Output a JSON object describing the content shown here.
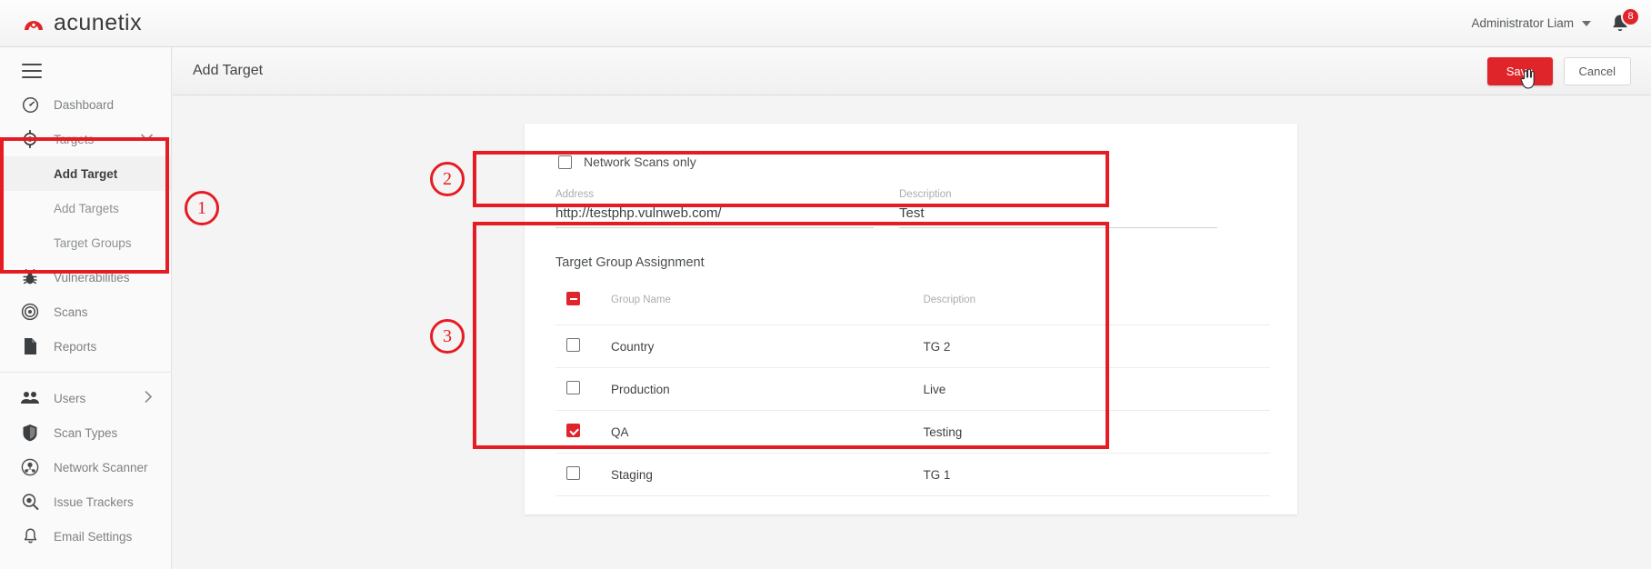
{
  "app": {
    "brand": "acunetix",
    "brand_icon": "acunetix-logo-icon"
  },
  "topbar": {
    "user_name": "Administrator Liam",
    "user_caret_icon": "chevron-down-icon",
    "bell_icon": "bell-icon",
    "notification_count": "8"
  },
  "sidebar": {
    "menu_icon": "hamburger-icon",
    "items": [
      {
        "label": "Dashboard",
        "icon": "gauge-icon",
        "type": "item"
      },
      {
        "label": "Targets",
        "icon": "crosshair-icon",
        "type": "item",
        "chevron": "chevron-down-icon",
        "expanded": true
      },
      {
        "label": "Add Target",
        "type": "sub",
        "active": true
      },
      {
        "label": "Add Targets",
        "type": "sub",
        "active": false
      },
      {
        "label": "Target Groups",
        "type": "sub",
        "active": false
      },
      {
        "label": "Vulnerabilities",
        "icon": "bug-icon",
        "type": "item"
      },
      {
        "label": "Scans",
        "icon": "radar-icon",
        "type": "item"
      },
      {
        "label": "Reports",
        "icon": "document-icon",
        "type": "item"
      },
      {
        "label": "Users",
        "icon": "users-icon",
        "type": "item",
        "chevron": "chevron-right-icon"
      },
      {
        "label": "Scan Types",
        "icon": "shield-icon",
        "type": "item"
      },
      {
        "label": "Network Scanner",
        "icon": "network-scanner-icon",
        "type": "item"
      },
      {
        "label": "Issue Trackers",
        "icon": "issue-tracker-icon",
        "type": "item"
      },
      {
        "label": "Email Settings",
        "icon": "bell-outline-icon",
        "type": "item"
      }
    ]
  },
  "page": {
    "title": "Add Target",
    "save_label": "Save",
    "cancel_label": "Cancel",
    "cursor_icon": "hand-pointer-icon"
  },
  "form": {
    "network_scans_only": {
      "label": "Network Scans only",
      "checked": false
    },
    "address": {
      "label": "Address",
      "value": "http://testphp.vulnweb.com/",
      "placeholder": "Address"
    },
    "description": {
      "label": "Description",
      "value": "Test",
      "placeholder": "Description"
    }
  },
  "target_group_assignment": {
    "title": "Target Group Assignment",
    "header_checkbox_state": "indeterminate",
    "columns": [
      "",
      "Group Name",
      "Description"
    ],
    "rows": [
      {
        "checked": false,
        "name": "Country",
        "description": "TG 2"
      },
      {
        "checked": false,
        "name": "Production",
        "description": "Live"
      },
      {
        "checked": true,
        "name": "QA",
        "description": "Testing"
      },
      {
        "checked": false,
        "name": "Staging",
        "description": "TG 1"
      }
    ]
  },
  "annotations": {
    "markers": [
      {
        "number": "1",
        "target": "sidebar-targets-section"
      },
      {
        "number": "2",
        "target": "address-description-fields"
      },
      {
        "number": "3",
        "target": "target-group-assignment-table"
      }
    ]
  },
  "colors": {
    "brand_red": "#e0252a",
    "annotation_red": "#e51c23",
    "sidebar_bg": "#fafafa",
    "content_bg": "#f4f4f4"
  }
}
